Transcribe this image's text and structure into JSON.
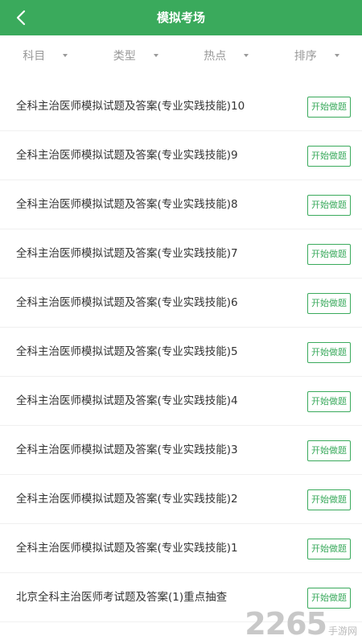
{
  "header": {
    "title": "模拟考场",
    "back_icon": "chevron-left-icon"
  },
  "filters": [
    {
      "label": "科目"
    },
    {
      "label": "类型"
    },
    {
      "label": "热点"
    },
    {
      "label": "排序"
    }
  ],
  "exam_button_label": "开始做题",
  "exams": [
    {
      "title": "全科主治医师模拟试题及答案(专业实践技能)10"
    },
    {
      "title": "全科主治医师模拟试题及答案(专业实践技能)9"
    },
    {
      "title": "全科主治医师模拟试题及答案(专业实践技能)8"
    },
    {
      "title": "全科主治医师模拟试题及答案(专业实践技能)7"
    },
    {
      "title": "全科主治医师模拟试题及答案(专业实践技能)6"
    },
    {
      "title": "全科主治医师模拟试题及答案(专业实践技能)5"
    },
    {
      "title": "全科主治医师模拟试题及答案(专业实践技能)4"
    },
    {
      "title": "全科主治医师模拟试题及答案(专业实践技能)3"
    },
    {
      "title": "全科主治医师模拟试题及答案(专业实践技能)2"
    },
    {
      "title": "全科主治医师模拟试题及答案(专业实践技能)1"
    },
    {
      "title": "北京全科主治医师考试题及答案(1)重点抽查"
    }
  ],
  "watermark": {
    "number": "2265",
    "text": "手游网"
  },
  "colors": {
    "accent": "#3aaa5c",
    "text": "#333333",
    "muted": "#999999"
  }
}
